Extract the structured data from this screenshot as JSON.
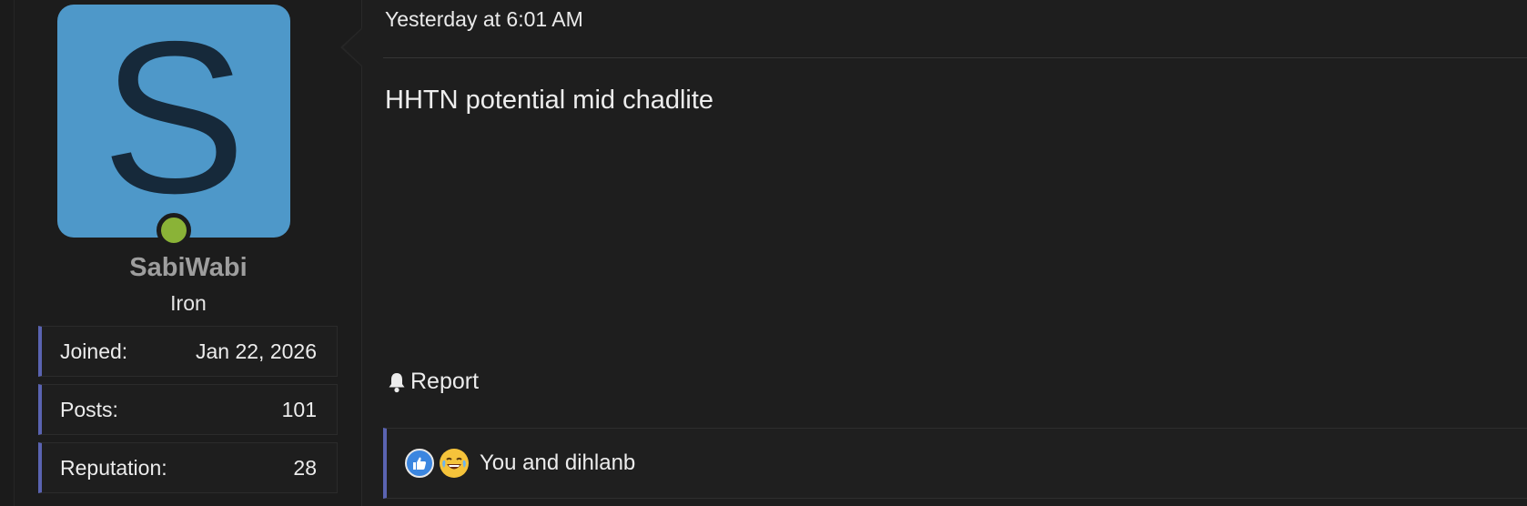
{
  "user": {
    "avatar_letter": "S",
    "avatar_color": "#4e98c9",
    "online_color": "#8ab337",
    "username": "SabiWabi",
    "title": "Iron",
    "stats": {
      "joined_label": "Joined:",
      "joined_value": "Jan 22, 2026",
      "posts_label": "Posts:",
      "posts_value": "101",
      "reputation_label": "Reputation:",
      "reputation_value": "28"
    }
  },
  "post": {
    "date": "Yesterday at 6:01 AM",
    "message": "HHTN potential mid chadlite",
    "report_label": "Report",
    "report_icon": "bell-icon"
  },
  "reactions": {
    "icons": [
      "like-icon",
      "laugh-icon"
    ],
    "text": "You and dihlanb"
  },
  "colors": {
    "accent": "#5a63b1",
    "background": "#1e1e1e"
  }
}
